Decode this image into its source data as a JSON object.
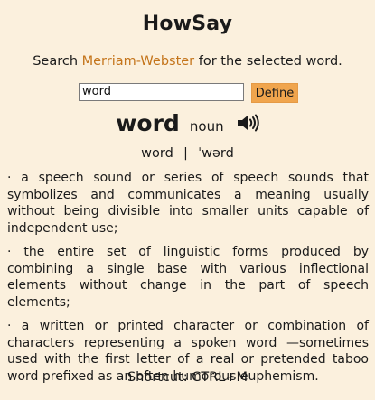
{
  "app": {
    "title": "HowSay"
  },
  "tagline": {
    "prefix": "Search ",
    "link_text": "Merriam-Webster",
    "suffix": " for the selected word."
  },
  "search": {
    "value": "word",
    "button_label": "Define"
  },
  "entry": {
    "headword": "word",
    "part_of_speech": "noun",
    "audio_icon": "speaker-icon",
    "pronunciation": "word  |  ˈwərd",
    "definitions": [
      "· a speech sound or series of speech sounds that symbolizes and communicates a meaning usually without being divisible into smaller units capable of independent use;",
      "· the entire set of linguistic forms produced by combining a single base with various inflectional elements without change in the part of speech elements;",
      "· a written or printed character or combination of characters representing a spoken word —sometimes used with the first letter of a real or pretended taboo word prefixed as an often humorous euphemism."
    ]
  },
  "footer": {
    "shortcut": "Shortcut: CTRL+M"
  },
  "colors": {
    "background": "#fbf0dd",
    "link": "#c4741a",
    "button": "#f0a54d"
  }
}
